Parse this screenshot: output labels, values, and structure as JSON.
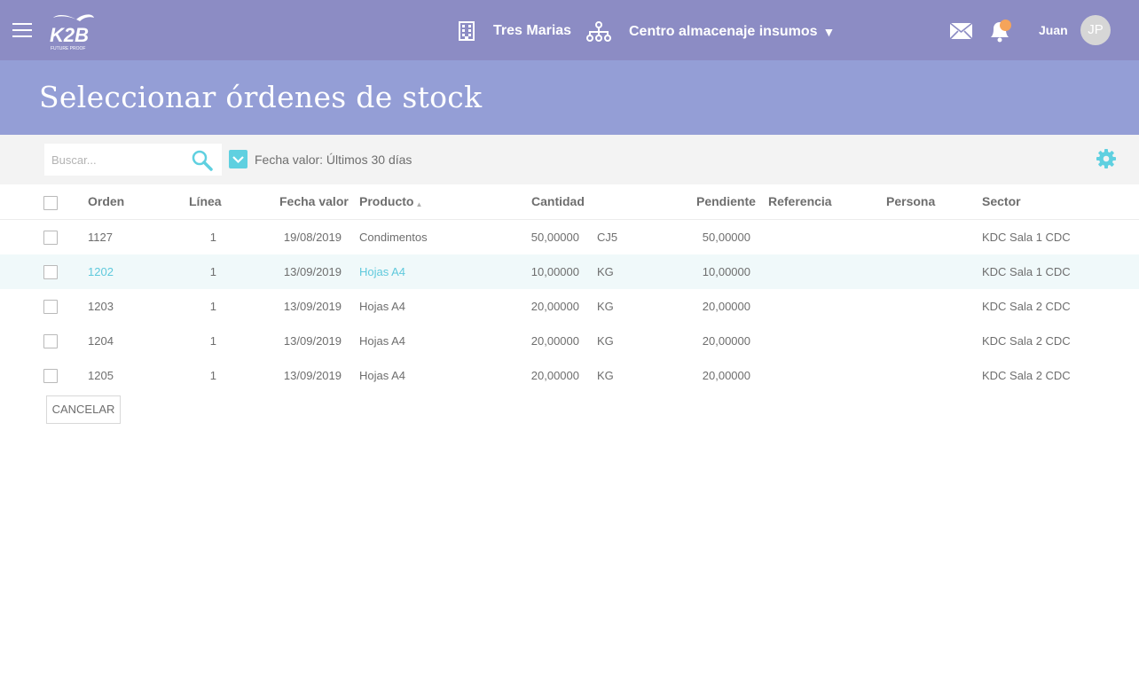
{
  "header": {
    "logo_text": "K2B",
    "logo_tagline": "FUTURE PROOF",
    "company": "Tres Marias",
    "center": "Centro almacenaje insumos",
    "center_caret": "▼",
    "user_name": "Juan",
    "user_initials": "JP",
    "icons": {
      "menu": "hamburger-icon",
      "company": "building-icon",
      "center": "org-tree-icon",
      "mail": "mail-icon",
      "notifications": "bell-icon"
    },
    "notification_dot_color": "#f5a45a"
  },
  "page": {
    "title": "Seleccionar órdenes de stock"
  },
  "filters": {
    "search_placeholder": "Buscar...",
    "search_value": "",
    "date_filter_checked": true,
    "date_filter_label": "Fecha valor: Últimos 30 días",
    "settings_icon": "gear-icon"
  },
  "table": {
    "columns": {
      "orden": "Orden",
      "linea": "Línea",
      "fecha": "Fecha valor",
      "producto": "Producto",
      "cantidad": "Cantidad",
      "pendiente": "Pendiente",
      "referencia": "Referencia",
      "persona": "Persona",
      "sector": "Sector"
    },
    "sort": {
      "column": "producto",
      "direction": "ascending",
      "glyph": "▲"
    },
    "rows": [
      {
        "orden": "1127",
        "linea": "1",
        "fecha": "19/08/2019",
        "producto": "Condimentos",
        "cantidad": "50,00000",
        "unidad": "CJ5",
        "pendiente": "50,00000",
        "referencia": "",
        "persona": "",
        "sector": "KDC Sala 1 CDC",
        "highlighted": false
      },
      {
        "orden": "1202",
        "linea": "1",
        "fecha": "13/09/2019",
        "producto": "Hojas A4",
        "cantidad": "10,00000",
        "unidad": "KG",
        "pendiente": "10,00000",
        "referencia": "",
        "persona": "",
        "sector": "KDC Sala 1 CDC",
        "highlighted": true
      },
      {
        "orden": "1203",
        "linea": "1",
        "fecha": "13/09/2019",
        "producto": "Hojas A4",
        "cantidad": "20,00000",
        "unidad": "KG",
        "pendiente": "20,00000",
        "referencia": "",
        "persona": "",
        "sector": "KDC Sala 2 CDC",
        "highlighted": false
      },
      {
        "orden": "1204",
        "linea": "1",
        "fecha": "13/09/2019",
        "producto": "Hojas A4",
        "cantidad": "20,00000",
        "unidad": "KG",
        "pendiente": "20,00000",
        "referencia": "",
        "persona": "",
        "sector": "KDC Sala 2 CDC",
        "highlighted": false
      },
      {
        "orden": "1205",
        "linea": "1",
        "fecha": "13/09/2019",
        "producto": "Hojas A4",
        "cantidad": "20,00000",
        "unidad": "KG",
        "pendiente": "20,00000",
        "referencia": "",
        "persona": "",
        "sector": "KDC Sala 2 CDC",
        "highlighted": false
      }
    ]
  },
  "actions": {
    "cancel_label": "CANCELAR"
  },
  "colors": {
    "topbar": "#8c8cc4",
    "titlebar": "#949ed6",
    "accent": "#5fd0e0",
    "link": "#5fc9dc",
    "filterbar": "#f3f3f3",
    "text": "#6e6e6e"
  }
}
